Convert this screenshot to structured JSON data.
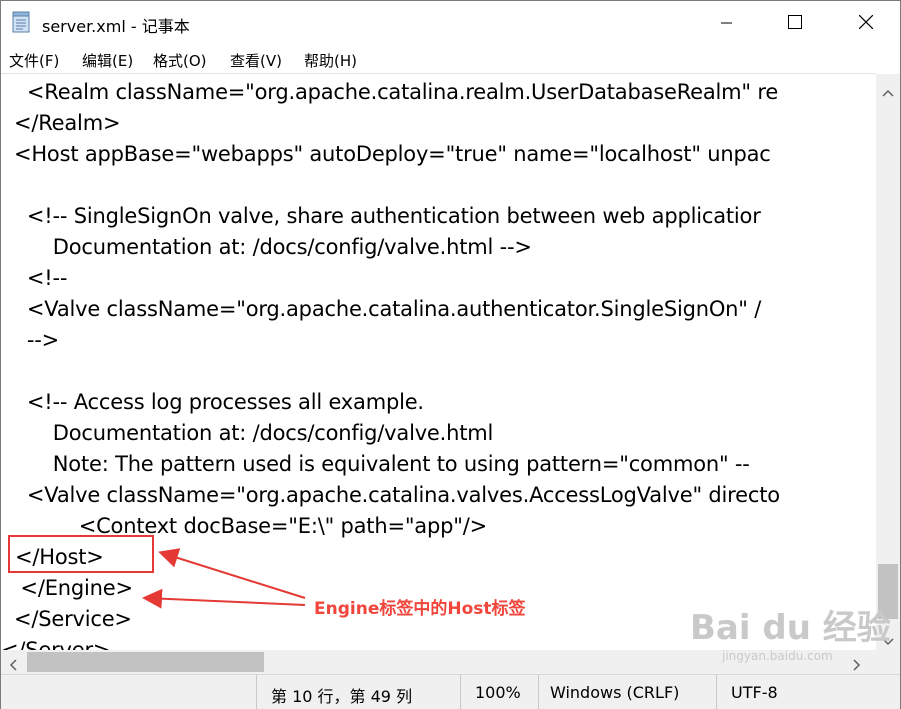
{
  "window": {
    "title": "server.xml - 记事本"
  },
  "menu": {
    "items": [
      "文件(F)",
      "编辑(E)",
      "格式(O)",
      "查看(V)",
      "帮助(H)"
    ]
  },
  "editor": {
    "lines": [
      "    <Realm className=\"org.apache.catalina.realm.UserDatabaseRealm\" re",
      "  </Realm>",
      "  <Host appBase=\"webapps\" autoDeploy=\"true\" name=\"localhost\" unpac",
      "",
      "    <!-- SingleSignOn valve, share authentication between web applicatior",
      "        Documentation at: /docs/config/valve.html -->",
      "    <!--",
      "    <Valve className=\"org.apache.catalina.authenticator.SingleSignOn\" /",
      "    -->",
      "",
      "    <!-- Access log processes all example.",
      "        Documentation at: /docs/config/valve.html",
      "        Note: The pattern used is equivalent to using pattern=\"common\" --",
      "    <Valve className=\"org.apache.catalina.valves.AccessLogValve\" directo",
      "            <Context docBase=\"E:\\\" path=\"app\"/>",
      "</Host>",
      "   </Engine>",
      "  </Service>",
      "</Server>"
    ]
  },
  "status": {
    "position": "第 10 行，第 49 列",
    "zoom": "100%",
    "line_ending": "Windows (CRLF)",
    "encoding": "UTF-8"
  },
  "annotation": {
    "label": "Engine标签中的Host标签",
    "color": "#e53935"
  },
  "watermark": {
    "brand": "Bai du 经验",
    "url": "jingyan.baidu.com"
  }
}
